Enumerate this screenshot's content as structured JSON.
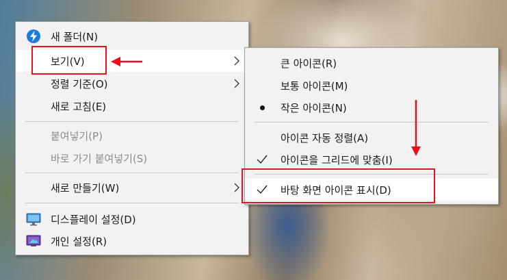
{
  "main_menu": {
    "new_folder": "새 폴더(N)",
    "view": "보기(V)",
    "sort_by": "정렬 기준(O)",
    "refresh": "새로 고침(E)",
    "paste": "붙여넣기(P)",
    "paste_shortcut": "바로 가기 붙여넣기(S)",
    "new": "새로 만들기(W)",
    "display_settings": "디스플레이 설정(D)",
    "personalize": "개인 설정(R)"
  },
  "view_submenu": {
    "large_icons": "큰 아이콘(R)",
    "medium_icons": "보통 아이콘(M)",
    "small_icons": "작은 아이콘(N)",
    "auto_arrange": "아이콘 자동 정렬(A)",
    "align_to_grid": "아이콘을 그리드에 맞춤(I)",
    "show_desktop_icons": "바탕 화면 아이콘 표시(D)",
    "selected_size": "small_icons",
    "align_to_grid_checked": true,
    "show_desktop_icons_checked": true,
    "auto_arrange_checked": false
  },
  "annotation": {
    "color": "#e8101a"
  },
  "icons": {
    "new_folder": "lightning-icon",
    "display_settings": "monitor-icon",
    "personalize": "personalize-icon",
    "submenu": "chevron-right-icon",
    "check": "checkmark-icon",
    "selected": "bullet-icon"
  }
}
